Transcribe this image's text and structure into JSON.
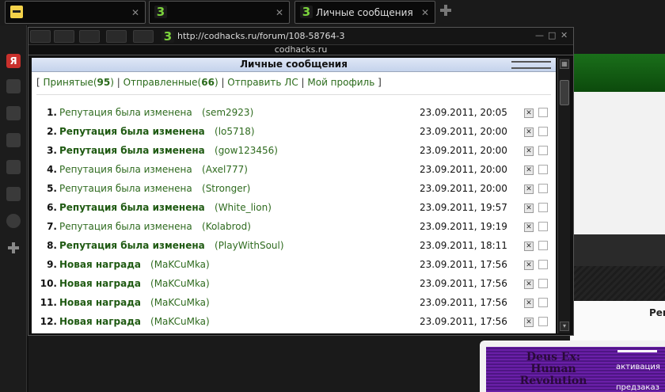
{
  "tabs": [
    {
      "label": "",
      "icon": "pixel-avatar-icon"
    },
    {
      "label": "",
      "icon": "codhacks-3-icon"
    },
    {
      "label": "Личные сообщения",
      "icon": "codhacks-3-icon"
    }
  ],
  "popup": {
    "url": "http://codhacks.ru/forum/108-58764-3",
    "domain": "codhacks.ru"
  },
  "pm": {
    "title": "Личные сообщения",
    "nav": {
      "received_label": "Принятые",
      "received_count": "95",
      "sent_label": "Отправленные",
      "sent_count": "66",
      "send_label": "Отправить ЛС",
      "profile_label": "Мой профиль"
    },
    "messages": [
      {
        "num": "1.",
        "title": "Репутация была изменена",
        "bold": false,
        "user": "sem2923",
        "date": "23.09.2011, 20:05"
      },
      {
        "num": "2.",
        "title": "Репутация была изменена",
        "bold": true,
        "user": "lo5718",
        "date": "23.09.2011, 20:00"
      },
      {
        "num": "3.",
        "title": "Репутация была изменена",
        "bold": true,
        "user": "gow123456",
        "date": "23.09.2011, 20:00"
      },
      {
        "num": "4.",
        "title": "Репутация была изменена",
        "bold": false,
        "user": "Axel777",
        "date": "23.09.2011, 20:00"
      },
      {
        "num": "5.",
        "title": "Репутация была изменена",
        "bold": false,
        "user": "Stronger",
        "date": "23.09.2011, 20:00"
      },
      {
        "num": "6.",
        "title": "Репутация была изменена",
        "bold": true,
        "user": "White_lion",
        "date": "23.09.2011, 19:57"
      },
      {
        "num": "7.",
        "title": "Репутация была изменена",
        "bold": false,
        "user": "Kolabrod",
        "date": "23.09.2011, 19:19"
      },
      {
        "num": "8.",
        "title": "Репутация была изменена",
        "bold": true,
        "user": "PlayWithSoul",
        "date": "23.09.2011, 18:11"
      },
      {
        "num": "9.",
        "title": "Новая награда",
        "bold": true,
        "user": "MaKCuMka",
        "date": "23.09.2011, 17:56"
      },
      {
        "num": "10.",
        "title": "Новая награда",
        "bold": true,
        "user": "MaKCuMka",
        "date": "23.09.2011, 17:56"
      },
      {
        "num": "11.",
        "title": "Новая награда",
        "bold": true,
        "user": "MaKCuMka",
        "date": "23.09.2011, 17:56"
      },
      {
        "num": "12.",
        "title": "Новая награда",
        "bold": true,
        "user": "MaKCuMka",
        "date": "23.09.2011, 17:56"
      }
    ]
  },
  "background": {
    "right_text": "Рен",
    "banner_title": "Deus Ex: Human Revolution",
    "banner_activation": "активация",
    "banner_preorder": "предзаказ"
  }
}
